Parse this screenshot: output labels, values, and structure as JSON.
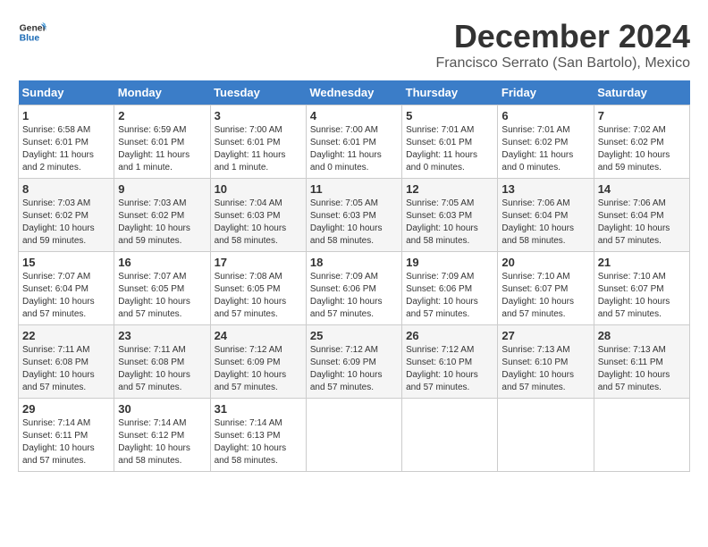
{
  "logo": {
    "line1": "General",
    "line2": "Blue"
  },
  "title": "December 2024",
  "subtitle": "Francisco Serrato (San Bartolo), Mexico",
  "headers": [
    "Sunday",
    "Monday",
    "Tuesday",
    "Wednesday",
    "Thursday",
    "Friday",
    "Saturday"
  ],
  "weeks": [
    [
      {
        "day": "1",
        "sunrise": "6:58 AM",
        "sunset": "6:01 PM",
        "daylight": "11 hours and 2 minutes."
      },
      {
        "day": "2",
        "sunrise": "6:59 AM",
        "sunset": "6:01 PM",
        "daylight": "11 hours and 1 minute."
      },
      {
        "day": "3",
        "sunrise": "7:00 AM",
        "sunset": "6:01 PM",
        "daylight": "11 hours and 1 minute."
      },
      {
        "day": "4",
        "sunrise": "7:00 AM",
        "sunset": "6:01 PM",
        "daylight": "11 hours and 0 minutes."
      },
      {
        "day": "5",
        "sunrise": "7:01 AM",
        "sunset": "6:01 PM",
        "daylight": "11 hours and 0 minutes."
      },
      {
        "day": "6",
        "sunrise": "7:01 AM",
        "sunset": "6:02 PM",
        "daylight": "11 hours and 0 minutes."
      },
      {
        "day": "7",
        "sunrise": "7:02 AM",
        "sunset": "6:02 PM",
        "daylight": "10 hours and 59 minutes."
      }
    ],
    [
      {
        "day": "8",
        "sunrise": "7:03 AM",
        "sunset": "6:02 PM",
        "daylight": "10 hours and 59 minutes."
      },
      {
        "day": "9",
        "sunrise": "7:03 AM",
        "sunset": "6:02 PM",
        "daylight": "10 hours and 59 minutes."
      },
      {
        "day": "10",
        "sunrise": "7:04 AM",
        "sunset": "6:03 PM",
        "daylight": "10 hours and 58 minutes."
      },
      {
        "day": "11",
        "sunrise": "7:05 AM",
        "sunset": "6:03 PM",
        "daylight": "10 hours and 58 minutes."
      },
      {
        "day": "12",
        "sunrise": "7:05 AM",
        "sunset": "6:03 PM",
        "daylight": "10 hours and 58 minutes."
      },
      {
        "day": "13",
        "sunrise": "7:06 AM",
        "sunset": "6:04 PM",
        "daylight": "10 hours and 58 minutes."
      },
      {
        "day": "14",
        "sunrise": "7:06 AM",
        "sunset": "6:04 PM",
        "daylight": "10 hours and 57 minutes."
      }
    ],
    [
      {
        "day": "15",
        "sunrise": "7:07 AM",
        "sunset": "6:04 PM",
        "daylight": "10 hours and 57 minutes."
      },
      {
        "day": "16",
        "sunrise": "7:07 AM",
        "sunset": "6:05 PM",
        "daylight": "10 hours and 57 minutes."
      },
      {
        "day": "17",
        "sunrise": "7:08 AM",
        "sunset": "6:05 PM",
        "daylight": "10 hours and 57 minutes."
      },
      {
        "day": "18",
        "sunrise": "7:09 AM",
        "sunset": "6:06 PM",
        "daylight": "10 hours and 57 minutes."
      },
      {
        "day": "19",
        "sunrise": "7:09 AM",
        "sunset": "6:06 PM",
        "daylight": "10 hours and 57 minutes."
      },
      {
        "day": "20",
        "sunrise": "7:10 AM",
        "sunset": "6:07 PM",
        "daylight": "10 hours and 57 minutes."
      },
      {
        "day": "21",
        "sunrise": "7:10 AM",
        "sunset": "6:07 PM",
        "daylight": "10 hours and 57 minutes."
      }
    ],
    [
      {
        "day": "22",
        "sunrise": "7:11 AM",
        "sunset": "6:08 PM",
        "daylight": "10 hours and 57 minutes."
      },
      {
        "day": "23",
        "sunrise": "7:11 AM",
        "sunset": "6:08 PM",
        "daylight": "10 hours and 57 minutes."
      },
      {
        "day": "24",
        "sunrise": "7:12 AM",
        "sunset": "6:09 PM",
        "daylight": "10 hours and 57 minutes."
      },
      {
        "day": "25",
        "sunrise": "7:12 AM",
        "sunset": "6:09 PM",
        "daylight": "10 hours and 57 minutes."
      },
      {
        "day": "26",
        "sunrise": "7:12 AM",
        "sunset": "6:10 PM",
        "daylight": "10 hours and 57 minutes."
      },
      {
        "day": "27",
        "sunrise": "7:13 AM",
        "sunset": "6:10 PM",
        "daylight": "10 hours and 57 minutes."
      },
      {
        "day": "28",
        "sunrise": "7:13 AM",
        "sunset": "6:11 PM",
        "daylight": "10 hours and 57 minutes."
      }
    ],
    [
      {
        "day": "29",
        "sunrise": "7:14 AM",
        "sunset": "6:11 PM",
        "daylight": "10 hours and 57 minutes."
      },
      {
        "day": "30",
        "sunrise": "7:14 AM",
        "sunset": "6:12 PM",
        "daylight": "10 hours and 58 minutes."
      },
      {
        "day": "31",
        "sunrise": "7:14 AM",
        "sunset": "6:13 PM",
        "daylight": "10 hours and 58 minutes."
      },
      null,
      null,
      null,
      null
    ]
  ]
}
